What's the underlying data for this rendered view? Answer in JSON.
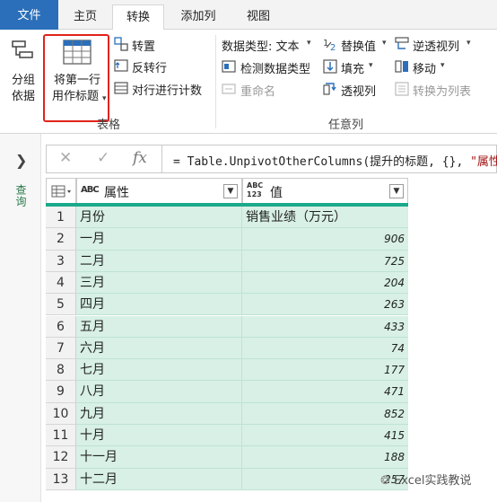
{
  "tabs": {
    "file": "文件",
    "home": "主页",
    "transform": "转换",
    "add_column": "添加列",
    "view": "视图"
  },
  "ribbon": {
    "group_by": [
      "分组",
      "依据"
    ],
    "use_first_row": [
      "将第一行",
      "用作标题"
    ],
    "transpose": "转置",
    "reverse_rows": "反转行",
    "count_rows": "对行进行计数",
    "table_group_label": "表格",
    "data_type": "数据类型: 文本",
    "detect_type": "检测数据类型",
    "rename": "重命名",
    "replace_values": "替换值",
    "fill": "填充",
    "pivot": "透视列",
    "unpivot": "逆透视列",
    "move": "移动",
    "to_list": "转换为列表",
    "any_column_label": "任意列"
  },
  "left_pane": {
    "label": "查询"
  },
  "formula_bar": {
    "fx": "fx",
    "prefix": "= Table.UnpivotOtherColumns(提升的标题, {}, ",
    "string_part": "\"属性"
  },
  "grid": {
    "col1_type": "ABC",
    "col1_header": "属性",
    "col2_type": "ABC 123",
    "col2_header": "值",
    "rows": [
      {
        "n": "1",
        "a": "月份",
        "v": "销售业绩（万元）",
        "numeric": false
      },
      {
        "n": "2",
        "a": "一月",
        "v": "906",
        "numeric": true
      },
      {
        "n": "3",
        "a": "二月",
        "v": "725",
        "numeric": true
      },
      {
        "n": "4",
        "a": "三月",
        "v": "204",
        "numeric": true
      },
      {
        "n": "5",
        "a": "四月",
        "v": "263",
        "numeric": true
      },
      {
        "n": "6",
        "a": "五月",
        "v": "433",
        "numeric": true
      },
      {
        "n": "7",
        "a": "六月",
        "v": "74",
        "numeric": true
      },
      {
        "n": "8",
        "a": "七月",
        "v": "177",
        "numeric": true
      },
      {
        "n": "9",
        "a": "八月",
        "v": "471",
        "numeric": true
      },
      {
        "n": "10",
        "a": "九月",
        "v": "852",
        "numeric": true
      },
      {
        "n": "11",
        "a": "十月",
        "v": "415",
        "numeric": true
      },
      {
        "n": "12",
        "a": "十一月",
        "v": "188",
        "numeric": true
      },
      {
        "n": "13",
        "a": "十二月",
        "v": "257",
        "numeric": true
      }
    ]
  },
  "watermark": "Excel实践教说",
  "colors": {
    "file_tab": "#2b6fba",
    "highlight_box": "#e0241b",
    "column_fill": "#d8f0e6",
    "column_accent": "#1aa98a"
  }
}
